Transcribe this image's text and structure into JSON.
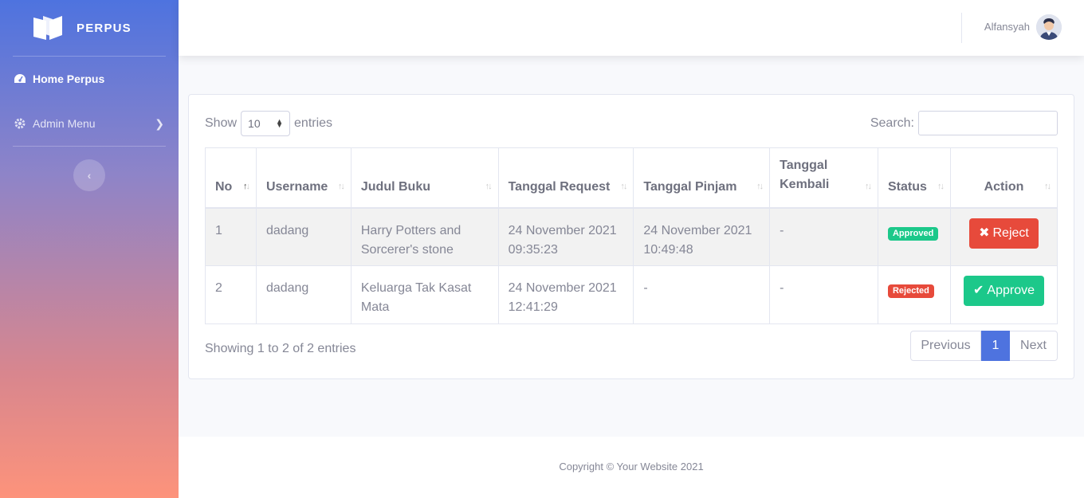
{
  "brand": {
    "name": "PERPUS",
    "icon": "open-book-icon"
  },
  "sidebar": {
    "items": [
      {
        "label": "Home Perpus",
        "icon": "dashboard-icon"
      },
      {
        "label": "Admin Menu",
        "icon": "gear-icon"
      }
    ],
    "toggle_icon": "chevron-left-icon"
  },
  "topbar": {
    "user_name": "Alfansyah"
  },
  "table_controls": {
    "show_label": "Show",
    "entries_value": "10",
    "entries_label": "entries",
    "search_label": "Search:",
    "search_value": ""
  },
  "table": {
    "headers": {
      "no": "No",
      "username": "Username",
      "judul": "Judul Buku",
      "request": "Tanggal Request",
      "pinjam": "Tanggal Pinjam",
      "kembali": "Tanggal Kembali",
      "status": "Status",
      "action": "Action"
    },
    "rows": [
      {
        "no": "1",
        "username": "dadang",
        "judul": "Harry Potters and Sorcerer's stone",
        "request": "24 November 2021 09:35:23",
        "pinjam": "24 November 2021 10:49:48",
        "kembali": "-",
        "status": "Approved",
        "action": "Reject"
      },
      {
        "no": "2",
        "username": "dadang",
        "judul": "Keluarga Tak Kasat Mata",
        "request": "24 November 2021 12:41:29",
        "pinjam": "-",
        "kembali": "-",
        "status": "Rejected",
        "action": "Approve"
      }
    ]
  },
  "pagination": {
    "info": "Showing 1 to 2 of 2 entries",
    "previous": "Previous",
    "current": "1",
    "next": "Next"
  },
  "footer": {
    "copyright": "Copyright © Your Website 2021"
  },
  "colors": {
    "primary": "#4e73df",
    "success": "#1cc88a",
    "danger": "#e74a3b"
  }
}
